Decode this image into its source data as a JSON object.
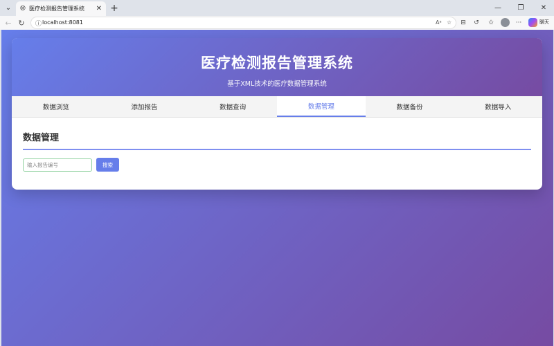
{
  "browser": {
    "tab_title": "医疗检测报告管理系统",
    "url": "localhost:8081",
    "chat_label": "聊天"
  },
  "app": {
    "title": "医疗检测报告管理系统",
    "subtitle": "基于XML技术的医疗数据管理系统",
    "tabs": [
      {
        "label": "数据浏览"
      },
      {
        "label": "添加报告"
      },
      {
        "label": "数据查询"
      },
      {
        "label": "数据管理"
      },
      {
        "label": "数据备份"
      },
      {
        "label": "数据导入"
      }
    ],
    "active_tab": "数据管理",
    "section": {
      "heading": "数据管理",
      "search_placeholder": "输入报告编号",
      "search_value": "",
      "search_button": "搜索"
    }
  },
  "colors": {
    "accent": "#667eea",
    "gradient_start": "#667eea",
    "gradient_end": "#764ba2"
  }
}
